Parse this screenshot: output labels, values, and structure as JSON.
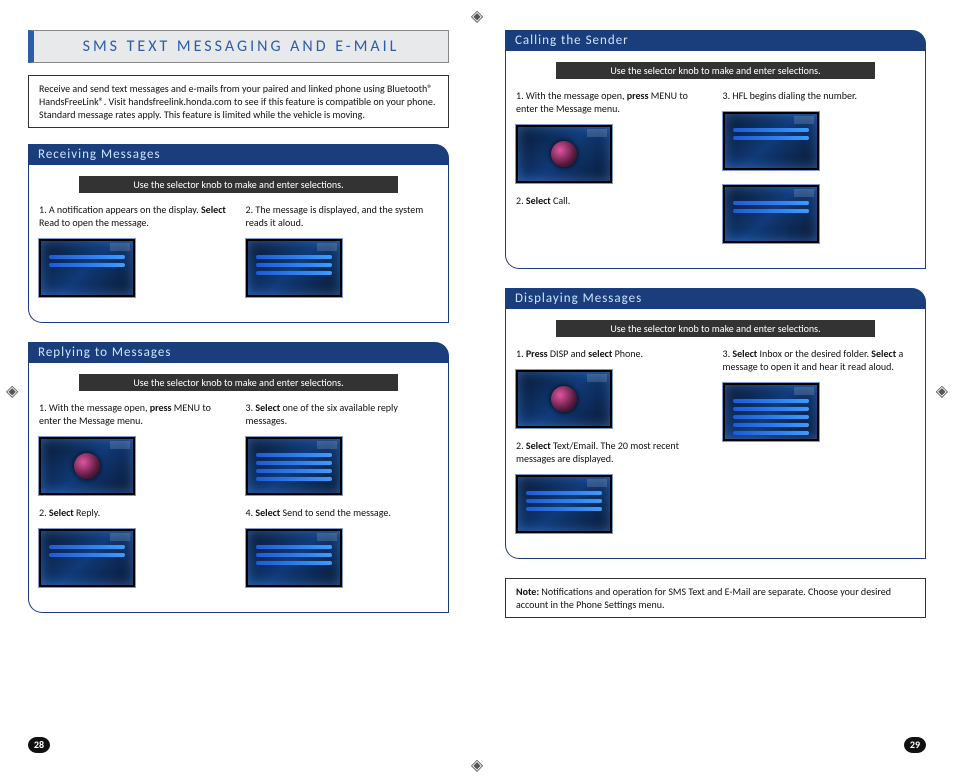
{
  "title": "SMS TEXT MESSAGING AND E-MAIL",
  "intro": "Receive and send text messages and e-mails from your paired and linked phone using Bluetooth® HandsFreeLink®. Visit handsfreelink.honda.com to see if this feature is compatible on your phone. Standard message rates apply. This feature is limited while the vehicle is moving.",
  "knob_instruction": "Use the selector knob to make and enter selections.",
  "sections": {
    "receiving": {
      "title": "Receiving Messages",
      "steps": {
        "s1a": "1.  A notification appears on the display. ",
        "s1b": "Select",
        "s1c": " Read to open the message.",
        "s2": "2. The message is displayed, and the system reads it aloud."
      }
    },
    "replying": {
      "title": "Replying to Messages",
      "steps": {
        "s1a": "1.  With the message open, ",
        "s1b": "press",
        "s1c": " MENU to enter the Message menu.",
        "s2a": "2.  ",
        "s2b": "Select",
        "s2c": " Reply.",
        "s3a": "3. ",
        "s3b": "Select",
        "s3c": " one of the six available reply messages.",
        "s4a": "4. ",
        "s4b": "Select",
        "s4c": " Send to send the message."
      }
    },
    "calling": {
      "title": "Calling the Sender",
      "steps": {
        "s1a": "1.  With the message open, ",
        "s1b": "press",
        "s1c": " MENU to enter the Message menu.",
        "s2a": "2.  ",
        "s2b": "Select",
        "s2c": " Call.",
        "s3": "3. HFL begins dialing the number."
      }
    },
    "displaying": {
      "title": "Displaying Messages",
      "steps": {
        "s1a": "1. ",
        "s1b": "Press",
        "s1c": " DISP and ",
        "s1d": "select",
        "s1e": " Phone.",
        "s2a": "2. ",
        "s2b": "Select",
        "s2c": " Text/Email.  The 20 most recent messages are displayed.",
        "s3a": "3. ",
        "s3b": "Select",
        "s3c": " Inbox or the desired folder.  ",
        "s3d": "Select",
        "s3e": " a message to open it and hear it read aloud."
      }
    }
  },
  "note_label": "Note:",
  "note_text": " Notifications and operation for SMS Text and E-Mail are separate. Choose your desired account in the Phone Settings menu.",
  "page_left": "28",
  "page_right": "29"
}
